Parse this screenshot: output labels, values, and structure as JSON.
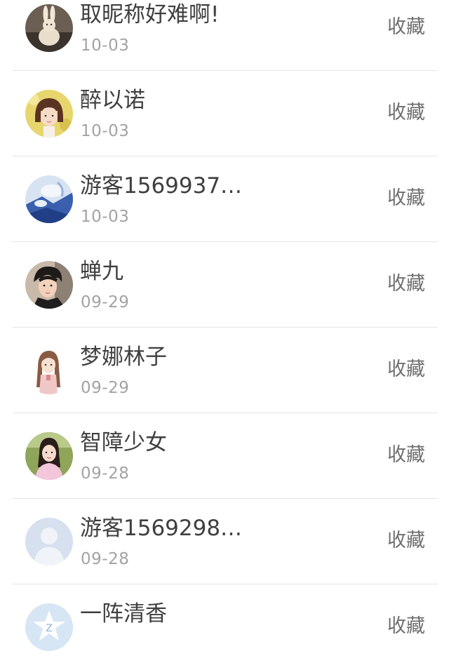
{
  "items": [
    {
      "name": "取昵称好难啊!",
      "date": "10-03",
      "action": "收藏",
      "avatar": "bunny-avatar-icon"
    },
    {
      "name": "醉以诺",
      "date": "10-03",
      "action": "收藏",
      "avatar": "girl-bob-avatar-icon"
    },
    {
      "name": "游客1569937…",
      "date": "10-03",
      "action": "收藏",
      "avatar": "blue-art-avatar-icon"
    },
    {
      "name": "蝉九",
      "date": "09-29",
      "action": "收藏",
      "avatar": "boy-avatar-icon"
    },
    {
      "name": "梦娜林子",
      "date": "09-29",
      "action": "收藏",
      "avatar": "anime-girl-avatar-icon"
    },
    {
      "name": "智障少女",
      "date": "09-28",
      "action": "收藏",
      "avatar": "girl-pink-avatar-icon"
    },
    {
      "name": "游客1569298…",
      "date": "09-28",
      "action": "收藏",
      "avatar": "default-user-avatar-icon"
    },
    {
      "name": "一阵清香",
      "date": "",
      "action": "收藏",
      "avatar": "star-avatar-icon"
    }
  ]
}
